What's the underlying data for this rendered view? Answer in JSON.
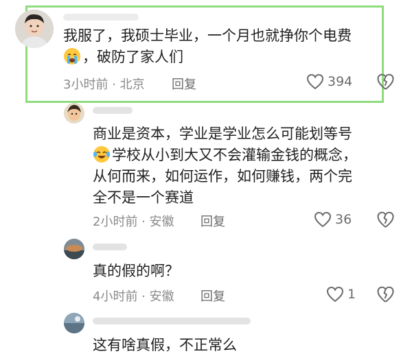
{
  "colors": {
    "highlight": "#8fdc7d",
    "meta": "#8a8a8a",
    "text": "#1f1f1f"
  },
  "comments": [
    {
      "text_lines": [
        "我服了，我硕士毕业，一个月也就挣你个电费",
        "，破防了家人们"
      ],
      "line2_emoji": "crying-face-emoji",
      "time_location": "3小时前 · 北京",
      "reply_label": "回复",
      "like_count": "394",
      "highlighted": true
    },
    {
      "text_lines": [
        "商业是资本，学业是学业怎么可能划等号",
        "学校从小到大又不会灌输金钱的概念，",
        "从何而来，如何运作，如何赚钱，两个完",
        "全不是一个赛道"
      ],
      "line2_emoji": "tears-of-joy-emoji",
      "time_location": "2小时前 · 安徽",
      "reply_label": "回复",
      "like_count": "36"
    },
    {
      "text_lines": [
        "真的假的啊？"
      ],
      "time_location": "4小时前 · 安徽",
      "reply_label": "回复",
      "like_count": "1"
    },
    {
      "text_lines": [
        "这有啥真假，不正常么"
      ]
    }
  ]
}
